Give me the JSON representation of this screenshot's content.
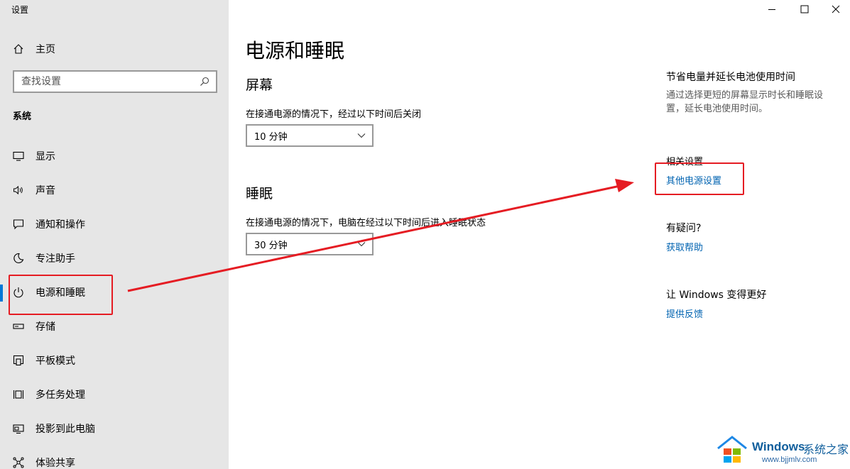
{
  "window": {
    "title": "设置",
    "controls": {
      "minimize": "minimize-icon",
      "maximize": "maximize-icon",
      "close": "close-icon"
    }
  },
  "sidebar": {
    "home_label": "主页",
    "search_placeholder": "查找设置",
    "section": "系统",
    "items": [
      {
        "label": "显示",
        "icon": "display-icon"
      },
      {
        "label": "声音",
        "icon": "speaker-icon"
      },
      {
        "label": "通知和操作",
        "icon": "notification-icon"
      },
      {
        "label": "专注助手",
        "icon": "moon-icon"
      },
      {
        "label": "电源和睡眠",
        "icon": "power-icon",
        "selected": true
      },
      {
        "label": "存储",
        "icon": "storage-icon"
      },
      {
        "label": "平板模式",
        "icon": "tablet-icon"
      },
      {
        "label": "多任务处理",
        "icon": "multitask-icon"
      },
      {
        "label": "投影到此电脑",
        "icon": "project-icon"
      },
      {
        "label": "体验共享",
        "icon": "share-icon"
      }
    ]
  },
  "main": {
    "title": "电源和睡眠",
    "screen": {
      "heading": "屏幕",
      "description": "在接通电源的情况下，经过以下时间后关闭",
      "value": "10 分钟"
    },
    "sleep": {
      "heading": "睡眠",
      "description": "在接通电源的情况下，电脑在经过以下时间后进入睡眠状态",
      "value": "30 分钟"
    }
  },
  "right_panel": {
    "tip_title": "节省电量并延长电池使用时间",
    "tip_desc": "通过选择更短的屏幕显示时长和睡眠设置，延长电池使用时间。",
    "related_title": "相关设置",
    "related_link": "其他电源设置",
    "question_title": "有疑问?",
    "help_link": "获取帮助",
    "feedback_title": "让 Windows 变得更好",
    "feedback_link": "提供反馈"
  },
  "annotation": {
    "color": "#e51c23"
  },
  "watermark": {
    "brand": "Windows",
    "brand_cn": "系统之家",
    "url": "www.bjjmlv.com"
  },
  "colors": {
    "accent": "#0078d7",
    "link": "#0063b1",
    "sidebar_bg": "#e6e6e6"
  }
}
